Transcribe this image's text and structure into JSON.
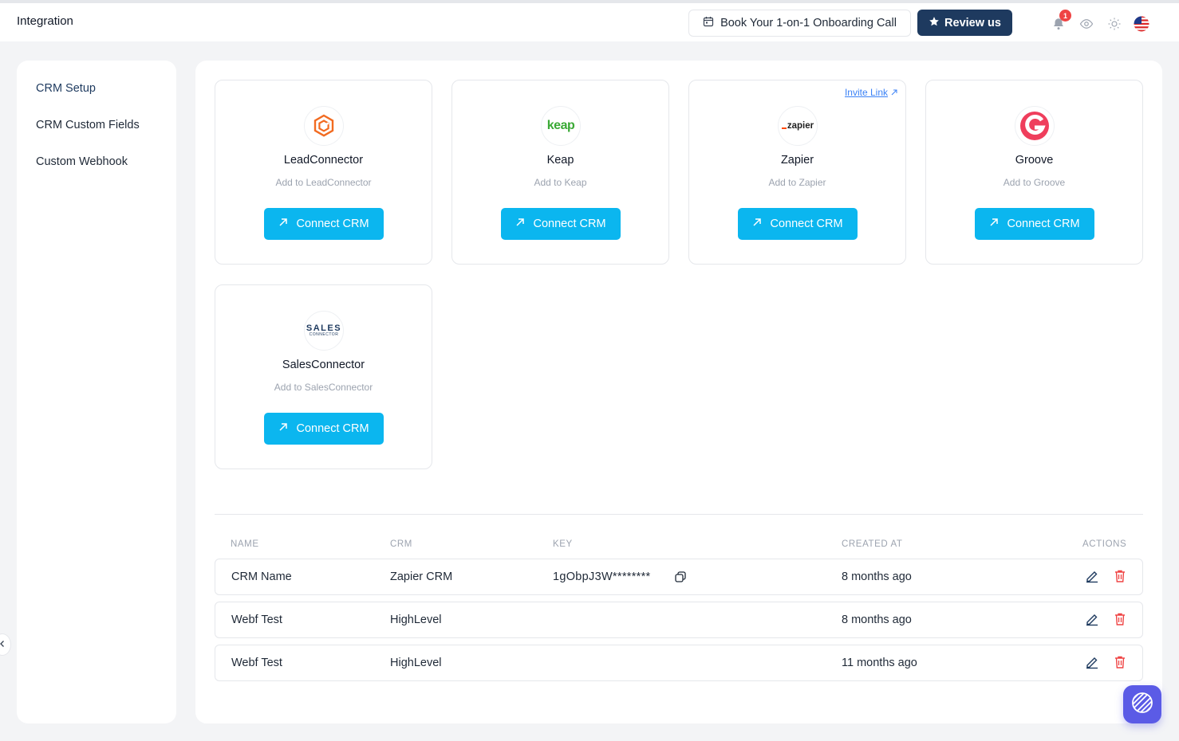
{
  "header": {
    "title": "Integration",
    "book_call_label": "Book Your 1-on-1 Onboarding Call",
    "review_label": "Review us",
    "notification_count": "1"
  },
  "sidebar": {
    "items": [
      {
        "label": "CRM Setup",
        "active": true
      },
      {
        "label": "CRM Custom Fields",
        "active": false
      },
      {
        "label": "Custom Webhook",
        "active": false
      }
    ]
  },
  "crm_cards": [
    {
      "name": "LeadConnector",
      "subtitle": "Add to LeadConnector",
      "button": "Connect CRM",
      "logo": "leadconnector-logo"
    },
    {
      "name": "Keap",
      "subtitle": "Add to Keap",
      "button": "Connect CRM",
      "logo": "keap-logo",
      "logo_text": "keap"
    },
    {
      "name": "Zapier",
      "subtitle": "Add to Zapier",
      "button": "Connect CRM",
      "logo": "zapier-logo",
      "logo_text": "zapier",
      "invite_link": "Invite Link"
    },
    {
      "name": "Groove",
      "subtitle": "Add to Groove",
      "button": "Connect CRM",
      "logo": "groove-logo"
    },
    {
      "name": "SalesConnector",
      "subtitle": "Add to SalesConnector",
      "button": "Connect CRM",
      "logo": "salesconnector-logo",
      "logo_text": "SALES",
      "logo_subtext": "CONNECTOR"
    }
  ],
  "table": {
    "columns": [
      "NAME",
      "CRM",
      "KEY",
      "CREATED AT",
      "ACTIONS"
    ],
    "rows": [
      {
        "name": "CRM Name",
        "crm": "Zapier CRM",
        "key": "1gObpJ3W********",
        "created": "8 months ago"
      },
      {
        "name": "Webf Test",
        "crm": "HighLevel",
        "key": "",
        "created": "8 months ago"
      },
      {
        "name": "Webf Test",
        "crm": "HighLevel",
        "key": "",
        "created": "11 months ago"
      }
    ]
  },
  "colors": {
    "primary_dark": "#1e3a5f",
    "connect_button": "#0bb6ef",
    "delete": "#ef4444",
    "help_fab": "#5b5be6"
  }
}
